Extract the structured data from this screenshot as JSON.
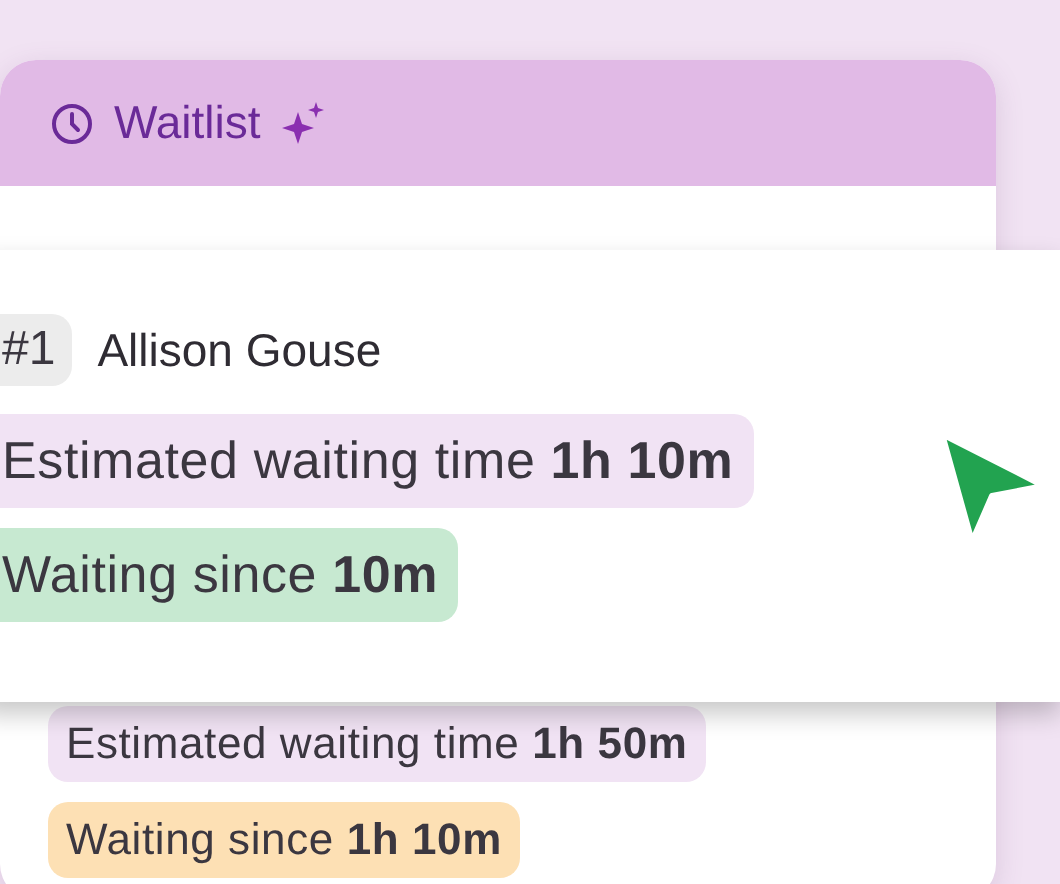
{
  "header": {
    "title": "Waitlist"
  },
  "popup_entry": {
    "number": "#1",
    "name": "Allison Gouse",
    "chips": [
      {
        "text": "Estimated waiting time **1h 10m**",
        "color": "#f1e3f4"
      },
      {
        "text": "Waiting since **10m**",
        "color": "#c7e9d1"
      }
    ]
  },
  "background_entry": {
    "chips": [
      {
        "text": "Estimated waiting time **1h 50m**",
        "color": "#f1e3f4"
      },
      {
        "text": "Waiting since **1h 10m**",
        "color": "#fde0b4"
      }
    ]
  }
}
